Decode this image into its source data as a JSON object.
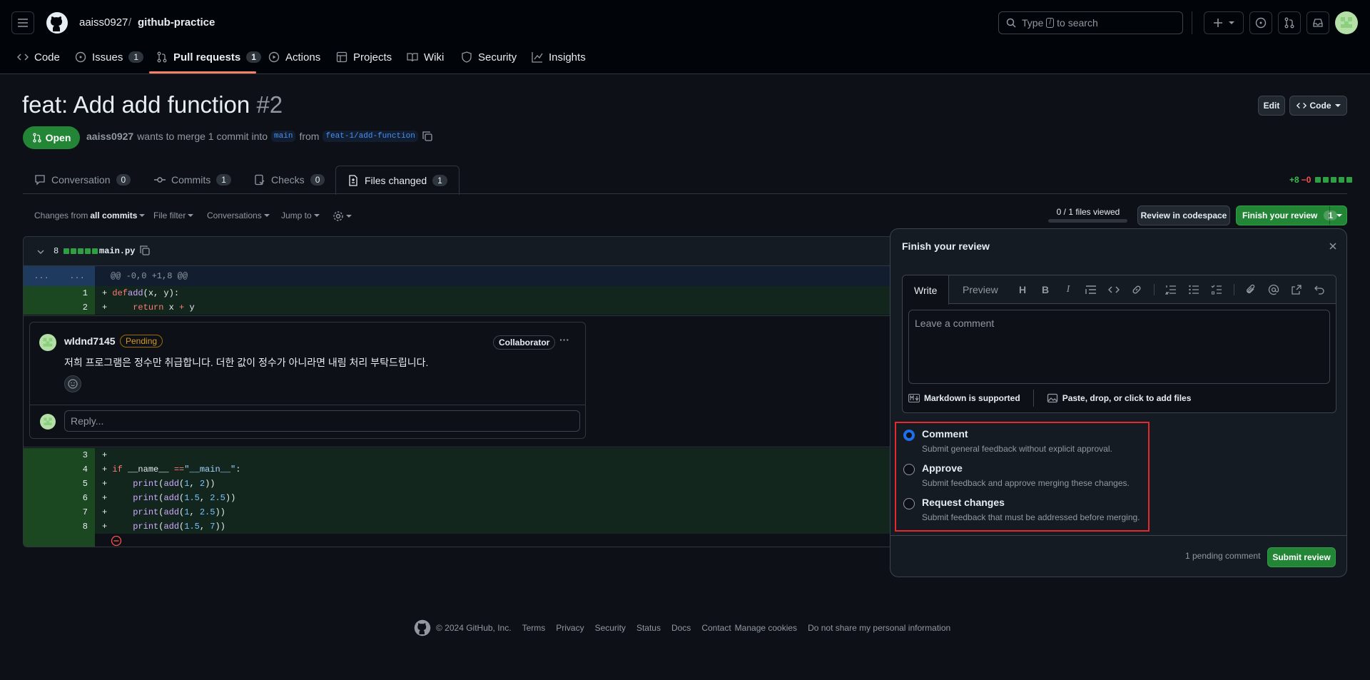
{
  "header": {
    "owner": "aaiss0927",
    "separator": "/",
    "repo": "github-practice",
    "search_prefix": "Type",
    "search_key": "/",
    "search_suffix": "to search"
  },
  "nav": {
    "code": "Code",
    "issues": "Issues",
    "issues_count": "1",
    "pulls": "Pull requests",
    "pulls_count": "1",
    "actions": "Actions",
    "projects": "Projects",
    "wiki": "Wiki",
    "security": "Security",
    "insights": "Insights"
  },
  "pr": {
    "title": "feat: Add add function",
    "number": "#2",
    "edit": "Edit",
    "code_btn": "Code",
    "state": "Open",
    "author": "aaiss0927",
    "merge_text": "wants to merge 1 commit into",
    "base": "main",
    "from": "from",
    "head": "feat-1/add-function"
  },
  "tabs": {
    "conversation": "Conversation",
    "conversation_count": "0",
    "commits": "Commits",
    "commits_count": "1",
    "checks": "Checks",
    "checks_count": "0",
    "files": "Files changed",
    "files_count": "1",
    "additions": "+8",
    "deletions": "−0"
  },
  "toolbar": {
    "changes_from": "Changes from",
    "all_commits": "all commits",
    "file_filter": "File filter",
    "conversations": "Conversations",
    "jump_to": "Jump to",
    "files_viewed": "0 / 1 files viewed",
    "files_viewed_fraction": 0,
    "review_codespace": "Review in codespace",
    "finish_review": "Finish your review",
    "finish_count": "1"
  },
  "file": {
    "changes": "8",
    "name": "main.py",
    "hunk_left": "...",
    "hunk_right": "...",
    "hunk_header": "@@ -0,0 +1,8 @@"
  },
  "comment": {
    "author": "wldnd7145",
    "status": "Pending",
    "role": "Collaborator",
    "more": "···",
    "body": "저희 프로그램은 정수만 취급합니다. 더한 값이 정수가 아니라면 내림 처리 부탁드립니다.",
    "reply_placeholder": "Reply..."
  },
  "review": {
    "title": "Finish your review",
    "write": "Write",
    "preview": "Preview",
    "placeholder": "Leave a comment",
    "markdown": "Markdown is supported",
    "attach": "Paste, drop, or click to add files",
    "options": [
      {
        "label": "Comment",
        "desc": "Submit general feedback without explicit approval."
      },
      {
        "label": "Approve",
        "desc": "Submit feedback and approve merging these changes."
      },
      {
        "label": "Request changes",
        "desc": "Submit feedback that must be addressed before merging."
      }
    ],
    "pending": "1 pending comment",
    "submit": "Submit review"
  },
  "footer": {
    "copyright": "© 2024 GitHub, Inc.",
    "links": [
      "Terms",
      "Privacy",
      "Security",
      "Status",
      "Docs",
      "Contact",
      "Manage cookies",
      "Do not share my personal information"
    ]
  },
  "colors": {
    "accent_green": "#238636",
    "link_blue": "#4493f8",
    "highlight_red": "#e5282b",
    "nav_underline": "#f78166"
  }
}
